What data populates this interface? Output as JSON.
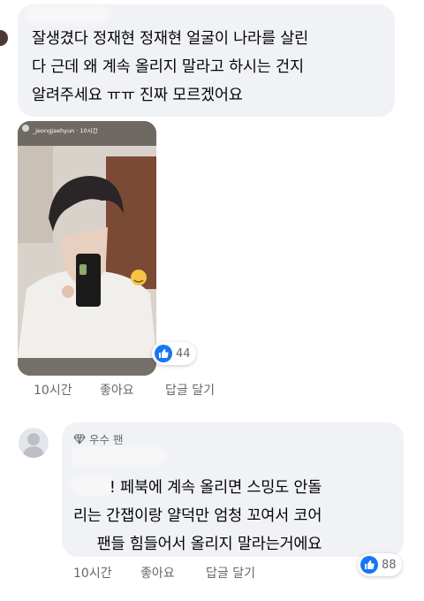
{
  "comment1": {
    "lines": [
      "잘생겼다 정재현 정재현 얼굴이 나라를 살린",
      "다 근데 왜 계속 올리지 말라고 하시는 건지",
      "알려주세요 ㅠㅠ 진짜 모르겠어요"
    ],
    "story_username": "_jeongjaehyun · 10시간",
    "reaction_count": "44",
    "time": "10시간",
    "like_label": "좋아요",
    "reply_label": "답글 달기"
  },
  "comment2": {
    "badge_label": "우수 팬",
    "lines": [
      "! 페북에 계속 올리면 스밍도 안돌",
      "리는 간잽이랑 얄덕만 엄청 꼬여서 코어",
      "팬들 힘들어서 올리지 말라는거에요"
    ],
    "reaction_count": "88",
    "time": "10시간",
    "like_label": "좋아요",
    "reply_label": "답글 달기"
  },
  "colors": {
    "bubble": "#f0f2f5",
    "meta_text": "#65676b",
    "like_blue": "#1877f2"
  },
  "icons": [
    "thumbs-up-icon",
    "diamond-icon",
    "default-avatar-icon",
    "smile-emoji-icon"
  ]
}
